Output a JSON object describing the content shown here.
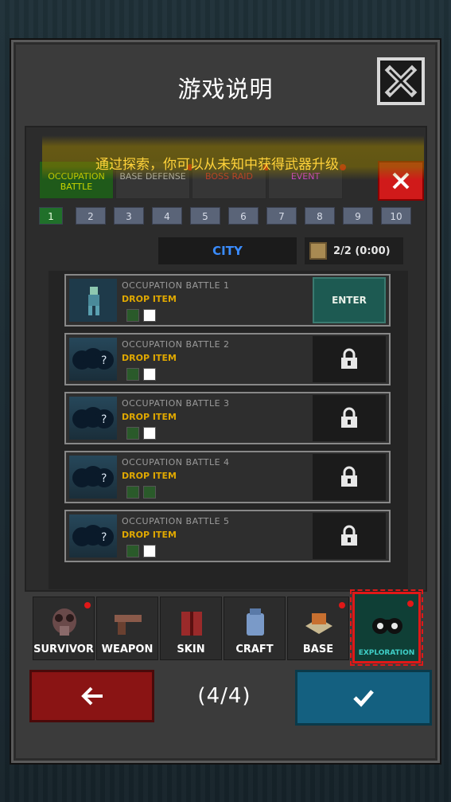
{
  "dialog": {
    "title": "游戏说明",
    "page_indicator": "(4/4)"
  },
  "screenshot": {
    "tooltip": "通过探索，你可以从未知中获得武器升级",
    "top_tabs": [
      {
        "label": "OCCUPATION BATTLE",
        "color": "#c7d400"
      },
      {
        "label": "BASE DEFENSE",
        "color": "#b0b0b0"
      },
      {
        "label": "BOSS RAID",
        "color": "#c0392b"
      },
      {
        "label": "EVENT",
        "color": "#d040d0"
      }
    ],
    "pages": [
      "1",
      "2",
      "3",
      "4",
      "5",
      "6",
      "7",
      "8",
      "9",
      "10"
    ],
    "active_page": "1",
    "location": "CITY",
    "entries": "2/2 (0:00)",
    "battles": [
      {
        "title": "OCCUPATION BATTLE 1",
        "drop": "DROP ITEM",
        "action": "ENTER",
        "locked": false
      },
      {
        "title": "OCCUPATION BATTLE 2",
        "drop": "DROP ITEM",
        "locked": true
      },
      {
        "title": "OCCUPATION BATTLE 3",
        "drop": "DROP ITEM",
        "locked": true
      },
      {
        "title": "OCCUPATION BATTLE 4",
        "drop": "DROP ITEM",
        "locked": true
      },
      {
        "title": "OCCUPATION BATTLE 5",
        "drop": "DROP ITEM",
        "locked": true
      }
    ]
  },
  "bottom_tabs": [
    {
      "label": "SURVIVOR",
      "icon": "gas-mask-icon",
      "badge": true
    },
    {
      "label": "WEAPON",
      "icon": "pistol-icon",
      "badge": false
    },
    {
      "label": "SKIN",
      "icon": "jacket-icon",
      "badge": false
    },
    {
      "label": "CRAFT",
      "icon": "backpack-icon",
      "badge": false
    },
    {
      "label": "BASE",
      "icon": "house-icon",
      "badge": true
    },
    {
      "label": "EXPLORATION",
      "icon": "binoculars-icon",
      "badge": true,
      "highlighted": true
    }
  ],
  "colors": {
    "back_button": "#8a1414",
    "confirm_button": "#146080",
    "highlight": "#e01818"
  }
}
